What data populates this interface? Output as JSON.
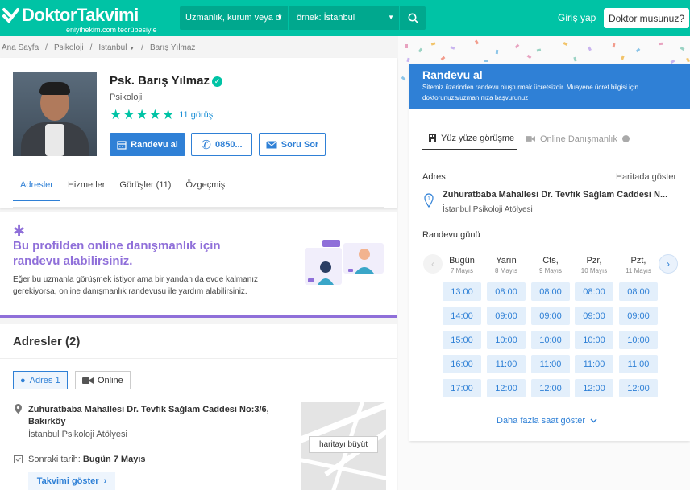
{
  "header": {
    "logo_text": "DoktorTakvimi",
    "logo_sub": "eniyihekim.com tecrübesiyle",
    "search_placeholder": "Uzmanlık, kurum veya d",
    "location_placeholder": "örnek: İstanbul",
    "login_label": "Giriş yap",
    "doctor_button": "Doktor musunuz?"
  },
  "breadcrumb": [
    "Ana Sayfa",
    "/",
    "Psikoloji",
    "/",
    "İstanbul",
    "/",
    "Barış Yılmaz"
  ],
  "profile": {
    "name": "Psk. Barış Yılmaz",
    "specialty": "Psikoloji",
    "rating": 5,
    "reviews": "11 görüş",
    "buttons": {
      "appointment": "Randevu al",
      "phone": "0850...",
      "question": "Soru Sor"
    },
    "tabs": [
      "Adresler",
      "Hizmetler",
      "Görüşler (11)",
      "Özgeçmiş"
    ]
  },
  "online_banner": {
    "title": "Bu profilden online danışmanlık için randevu alabilirsiniz.",
    "text": "Eğer bu uzmanla görüşmek istiyor ama bir yandan da evde kalmanız gerekiyorsa, online danışmanlık randevusu ile yardım alabilirsiniz."
  },
  "addresses": {
    "title": "Adresler (2)",
    "chips": [
      "Adres 1",
      "Online"
    ],
    "address": "Zuhuratbaba Mahallesi Dr. Tevfik Sağlam Caddesi No:3/6, Bakırköy",
    "clinic": "İstanbul Psikoloji Atölyesi",
    "next_label": "Sonraki tarih:",
    "next_value": "Bugün 7 Mayıs",
    "calendar_btn": "Takvimi göster",
    "map_btn": "haritayı büyüt"
  },
  "appointment": {
    "title": "Randevu al",
    "subtitle": "Sitemiz üzerinden randevu oluşturmak ücretsizdir. Muayene ücret bilgisi için doktorunuza/uzmanınıza başvurunuz",
    "tab_in_person": "Yüz yüze görüşme",
    "tab_online": "Online Danışmanlık",
    "address_label": "Adres",
    "map_link": "Haritada göster",
    "address": "Zuhuratbaba Mahallesi Dr. Tevfik Sağlam Caddesi N...",
    "clinic": "İstanbul Psikoloji Atölyesi",
    "day_label": "Randevu günü",
    "days": [
      {
        "name": "Bugün",
        "date": "7 Mayıs",
        "slots": [
          "13:00",
          "14:00",
          "15:00",
          "16:00",
          "17:00"
        ]
      },
      {
        "name": "Yarın",
        "date": "8 Mayıs",
        "slots": [
          "08:00",
          "09:00",
          "10:00",
          "11:00",
          "12:00"
        ]
      },
      {
        "name": "Cts,",
        "date": "9 Mayıs",
        "slots": [
          "08:00",
          "09:00",
          "10:00",
          "11:00",
          "12:00"
        ]
      },
      {
        "name": "Pzr,",
        "date": "10 Mayıs",
        "slots": [
          "08:00",
          "09:00",
          "10:00",
          "11:00",
          "12:00"
        ]
      },
      {
        "name": "Pzt,",
        "date": "11 Mayıs",
        "slots": [
          "08:00",
          "09:00",
          "10:00",
          "11:00",
          "12:00"
        ]
      }
    ],
    "more": "Daha fazla saat göster"
  },
  "colors": {
    "brand": "#00c3a5",
    "primary": "#2f80d6",
    "purple": "#8f6fd9"
  }
}
